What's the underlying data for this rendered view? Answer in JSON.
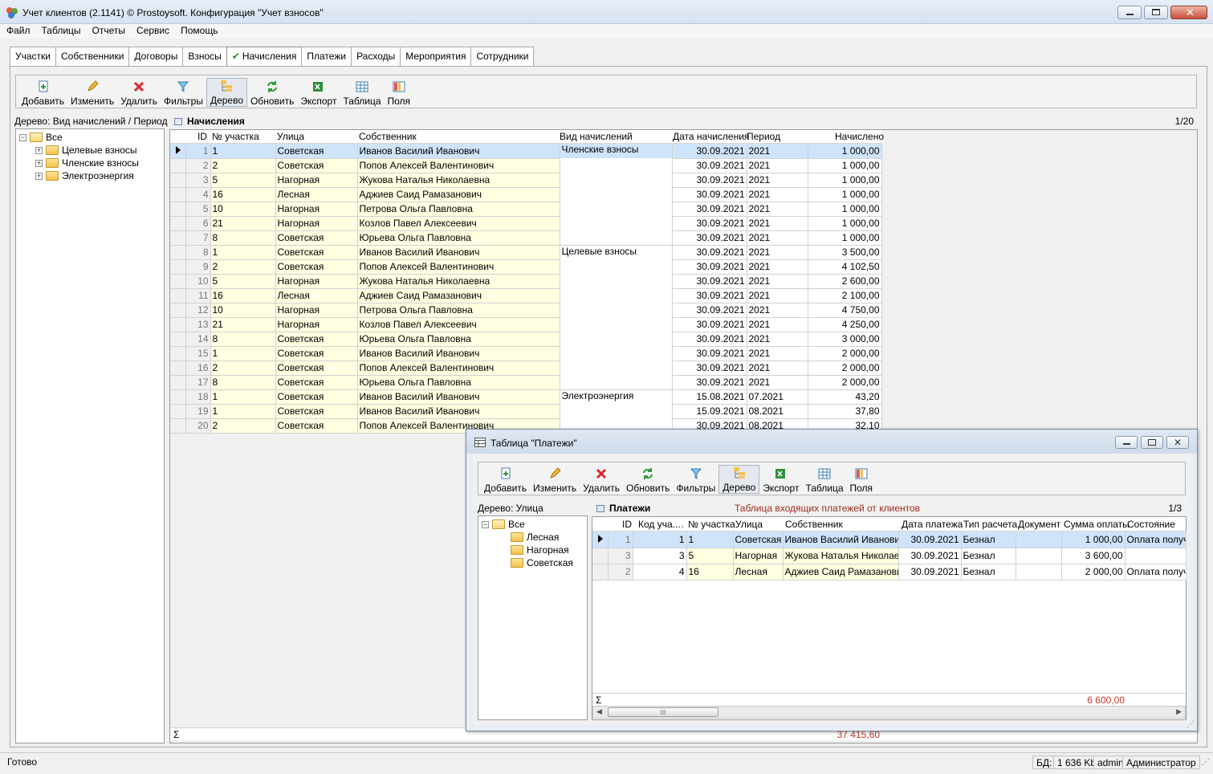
{
  "window": {
    "title": "Учет клиентов (2.1141) © Prostoysoft. Конфигурация \"Учет взносов\""
  },
  "menu": [
    "Файл",
    "Таблицы",
    "Отчеты",
    "Сервис",
    "Помощь"
  ],
  "tabs": [
    {
      "label": "Участки",
      "active": false
    },
    {
      "label": "Собственники",
      "active": false
    },
    {
      "label": "Договоры",
      "active": false
    },
    {
      "label": "Взносы",
      "active": false
    },
    {
      "label": "Начисления",
      "active": true
    },
    {
      "label": "Платежи",
      "active": false
    },
    {
      "label": "Расходы",
      "active": false
    },
    {
      "label": "Мероприятия",
      "active": false
    },
    {
      "label": "Сотрудники",
      "active": false
    }
  ],
  "toolbar": {
    "add": "Добавить",
    "edit": "Изменить",
    "delete": "Удалить",
    "filters": "Фильтры",
    "tree": "Дерево",
    "refresh": "Обновить",
    "export": "Экспорт",
    "table": "Таблица",
    "fields": "Поля"
  },
  "left_tree": {
    "label": "Дерево: Вид начислений / Период",
    "root": "Все",
    "children": [
      "Целевые взносы",
      "Членские взносы",
      "Электроэнергия"
    ]
  },
  "grid": {
    "caption": "Начисления",
    "page": "1/20",
    "columns": [
      "ID",
      "№ участка",
      "Улица",
      "Собственник",
      "Вид начислений",
      "Дата начисления",
      "Период",
      "Начислено"
    ],
    "groups": [
      {
        "name": "Членские взносы"
      },
      {
        "name": "Целевые взносы"
      },
      {
        "name": "Электроэнергия"
      }
    ],
    "rows": [
      {
        "id": "1",
        "plot": "1",
        "street": "Советская",
        "owner": "Иванов Василий Иванович",
        "kind": "Членские взносы",
        "date": "30.09.2021",
        "period": "2021",
        "amount": "1 000,00"
      },
      {
        "id": "2",
        "plot": "2",
        "street": "Советская",
        "owner": "Попов Алексей Валентинович",
        "kind": "",
        "date": "30.09.2021",
        "period": "2021",
        "amount": "1 000,00"
      },
      {
        "id": "3",
        "plot": "5",
        "street": "Нагорная",
        "owner": "Жукова Наталья Николаевна",
        "kind": "",
        "date": "30.09.2021",
        "period": "2021",
        "amount": "1 000,00"
      },
      {
        "id": "4",
        "plot": "16",
        "street": "Лесная",
        "owner": "Аджиев Саид Рамазанович",
        "kind": "",
        "date": "30.09.2021",
        "period": "2021",
        "amount": "1 000,00"
      },
      {
        "id": "5",
        "plot": "10",
        "street": "Нагорная",
        "owner": "Петрова Ольга Павловна",
        "kind": "",
        "date": "30.09.2021",
        "period": "2021",
        "amount": "1 000,00"
      },
      {
        "id": "6",
        "plot": "21",
        "street": "Нагорная",
        "owner": "Козлов Павел Алексеевич",
        "kind": "",
        "date": "30.09.2021",
        "period": "2021",
        "amount": "1 000,00"
      },
      {
        "id": "7",
        "plot": "8",
        "street": "Советская",
        "owner": "Юрьева Ольга Павловна",
        "kind": "",
        "date": "30.09.2021",
        "period": "2021",
        "amount": "1 000,00"
      },
      {
        "id": "8",
        "plot": "1",
        "street": "Советская",
        "owner": "Иванов Василий Иванович",
        "kind": "Целевые взносы",
        "date": "30.09.2021",
        "period": "2021",
        "amount": "3 500,00"
      },
      {
        "id": "9",
        "plot": "2",
        "street": "Советская",
        "owner": "Попов Алексей Валентинович",
        "kind": "",
        "date": "30.09.2021",
        "period": "2021",
        "amount": "4 102,50"
      },
      {
        "id": "10",
        "plot": "5",
        "street": "Нагорная",
        "owner": "Жукова Наталья Николаевна",
        "kind": "",
        "date": "30.09.2021",
        "period": "2021",
        "amount": "2 600,00"
      },
      {
        "id": "11",
        "plot": "16",
        "street": "Лесная",
        "owner": "Аджиев Саид Рамазанович",
        "kind": "",
        "date": "30.09.2021",
        "period": "2021",
        "amount": "2 100,00"
      },
      {
        "id": "12",
        "plot": "10",
        "street": "Нагорная",
        "owner": "Петрова Ольга Павловна",
        "kind": "",
        "date": "30.09.2021",
        "period": "2021",
        "amount": "4 750,00"
      },
      {
        "id": "13",
        "plot": "21",
        "street": "Нагорная",
        "owner": "Козлов Павел Алексеевич",
        "kind": "",
        "date": "30.09.2021",
        "period": "2021",
        "amount": "4 250,00"
      },
      {
        "id": "14",
        "plot": "8",
        "street": "Советская",
        "owner": "Юрьева Ольга Павловна",
        "kind": "",
        "date": "30.09.2021",
        "period": "2021",
        "amount": "3 000,00"
      },
      {
        "id": "15",
        "plot": "1",
        "street": "Советская",
        "owner": "Иванов Василий Иванович",
        "kind": "",
        "date": "30.09.2021",
        "period": "2021",
        "amount": "2 000,00"
      },
      {
        "id": "16",
        "plot": "2",
        "street": "Советская",
        "owner": "Попов Алексей Валентинович",
        "kind": "",
        "date": "30.09.2021",
        "period": "2021",
        "amount": "2 000,00"
      },
      {
        "id": "17",
        "plot": "8",
        "street": "Советская",
        "owner": "Юрьева Ольга Павловна",
        "kind": "",
        "date": "30.09.2021",
        "period": "2021",
        "amount": "2 000,00"
      },
      {
        "id": "18",
        "plot": "1",
        "street": "Советская",
        "owner": "Иванов Василий Иванович",
        "kind": "Электроэнергия",
        "date": "15.08.2021",
        "period": "07.2021",
        "amount": "43,20"
      },
      {
        "id": "19",
        "plot": "1",
        "street": "Советская",
        "owner": "Иванов Василий Иванович",
        "kind": "",
        "date": "15.09.2021",
        "period": "08.2021",
        "amount": "37,80"
      },
      {
        "id": "20",
        "plot": "2",
        "street": "Советская",
        "owner": "Попов Алексей Валентинович",
        "kind": "",
        "date": "30.09.2021",
        "period": "08.2021",
        "amount": "32,10"
      }
    ],
    "sum_symbol": "Σ",
    "total": "37 415,60"
  },
  "payments_window": {
    "title": "Таблица \"Платежи\"",
    "tree_label": "Дерево: Улица",
    "tree_root": "Все",
    "tree_children": [
      "Лесная",
      "Нагорная",
      "Советская"
    ],
    "caption": "Платежи",
    "description": "Таблица входящих платежей от клиентов",
    "page": "1/3",
    "columns": [
      "ID",
      "Код уча...",
      "№ участка",
      "Улица",
      "Собственник",
      "Дата платежа",
      "Тип расчета",
      "Документ",
      "Сумма оплаты",
      "Состояние"
    ],
    "rows": [
      {
        "id": "1",
        "code": "1",
        "plot": "1",
        "street": "Советская",
        "owner": "Иванов Василий Иванович",
        "date": "30.09.2021",
        "type": "Безнал",
        "doc": "",
        "sum": "1 000,00",
        "state": "Оплата получе"
      },
      {
        "id": "3",
        "code": "3",
        "plot": "5",
        "street": "Нагорная",
        "owner": "Жукова Наталья Николаев",
        "date": "30.09.2021",
        "type": "Безнал",
        "doc": "",
        "sum": "3 600,00",
        "state": ""
      },
      {
        "id": "2",
        "code": "4",
        "plot": "16",
        "street": "Лесная",
        "owner": "Аджиев Саид Рамазанович",
        "date": "30.09.2021",
        "type": "Безнал",
        "doc": "",
        "sum": "2 000,00",
        "state": "Оплата получе"
      }
    ],
    "sum_symbol": "Σ",
    "total": "6 600,00",
    "scroll_grip": "III"
  },
  "status": {
    "text": "Готово",
    "db_label": "БД:",
    "db_size": "1 636 Kb",
    "user": "admin",
    "role": "Администратор"
  },
  "colors": {
    "selected_row": "#cfe3fb",
    "yellow_cell": "#ffffe1",
    "total_text": "#c0392b",
    "check": "#2b8a2b"
  }
}
